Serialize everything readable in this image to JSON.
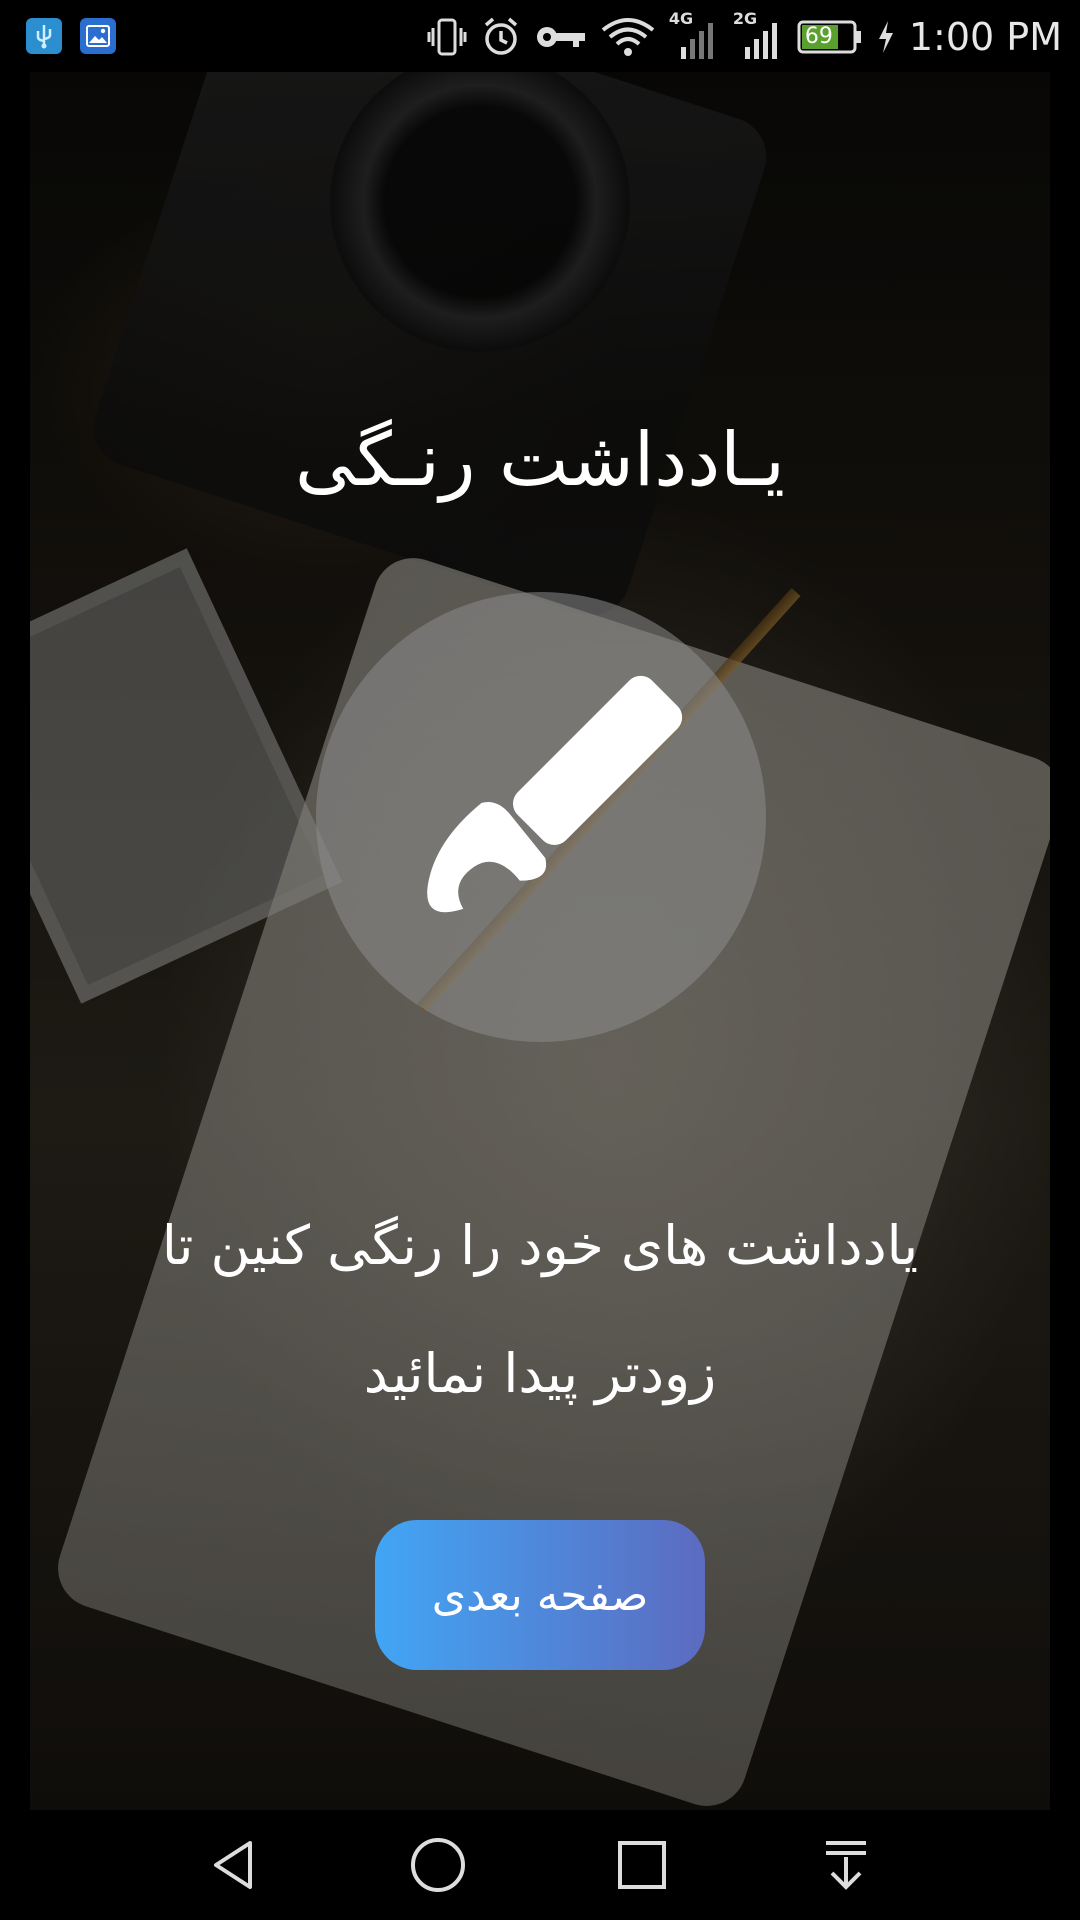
{
  "status_bar": {
    "time": "1:00 PM",
    "battery_level": "69",
    "network_primary": "4G",
    "network_secondary": "2G",
    "left_icons": [
      "usb-icon",
      "gallery-icon"
    ],
    "right_icons": [
      "vibrate-icon",
      "alarm-icon",
      "vpn-key-icon",
      "wifi-icon",
      "signal-4g-icon",
      "signal-2g-icon",
      "battery-icon",
      "charging-icon"
    ]
  },
  "onboarding": {
    "app_title": "یـادداشت رنـگی",
    "feature_icon": "paint-brush-icon",
    "description_line1": "یادداشت های خود را رنگی کنین تا",
    "description_line2": "زودتر پیدا نمائید",
    "next_button_label": "صفحه بعدی",
    "button_gradient": [
      "#42a5f5",
      "#5c6bc0"
    ]
  },
  "nav_bar": {
    "buttons": [
      "back-icon",
      "home-icon",
      "recents-icon",
      "notification-pull-icon"
    ]
  }
}
